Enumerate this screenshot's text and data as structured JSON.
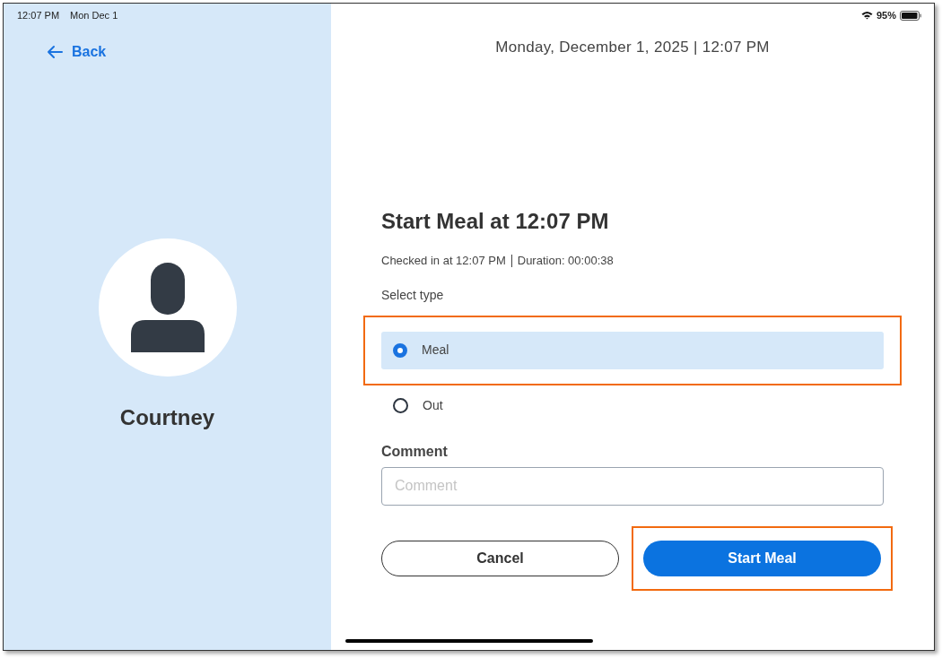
{
  "status_bar": {
    "time": "12:07 PM",
    "date": "Mon Dec 1",
    "battery": "95%"
  },
  "back": {
    "label": "Back"
  },
  "user": {
    "name": "Courtney"
  },
  "datetime": "Monday, December 1, 2025 | 12:07 PM",
  "title": "Start Meal at 12:07 PM",
  "checked_in": "Checked in at 12:07 PM",
  "duration": "Duration: 00:00:38",
  "type_label": "Select type",
  "types": [
    {
      "label": "Meal",
      "selected": true,
      "highlighted": true
    },
    {
      "label": "Out",
      "selected": false,
      "highlighted": false
    }
  ],
  "comment": {
    "label": "Comment",
    "placeholder": "Comment"
  },
  "buttons": [
    {
      "kind": "secondary",
      "label": "Cancel",
      "highlighted": false
    },
    {
      "kind": "primary",
      "label": "Start Meal",
      "highlighted": true
    }
  ]
}
